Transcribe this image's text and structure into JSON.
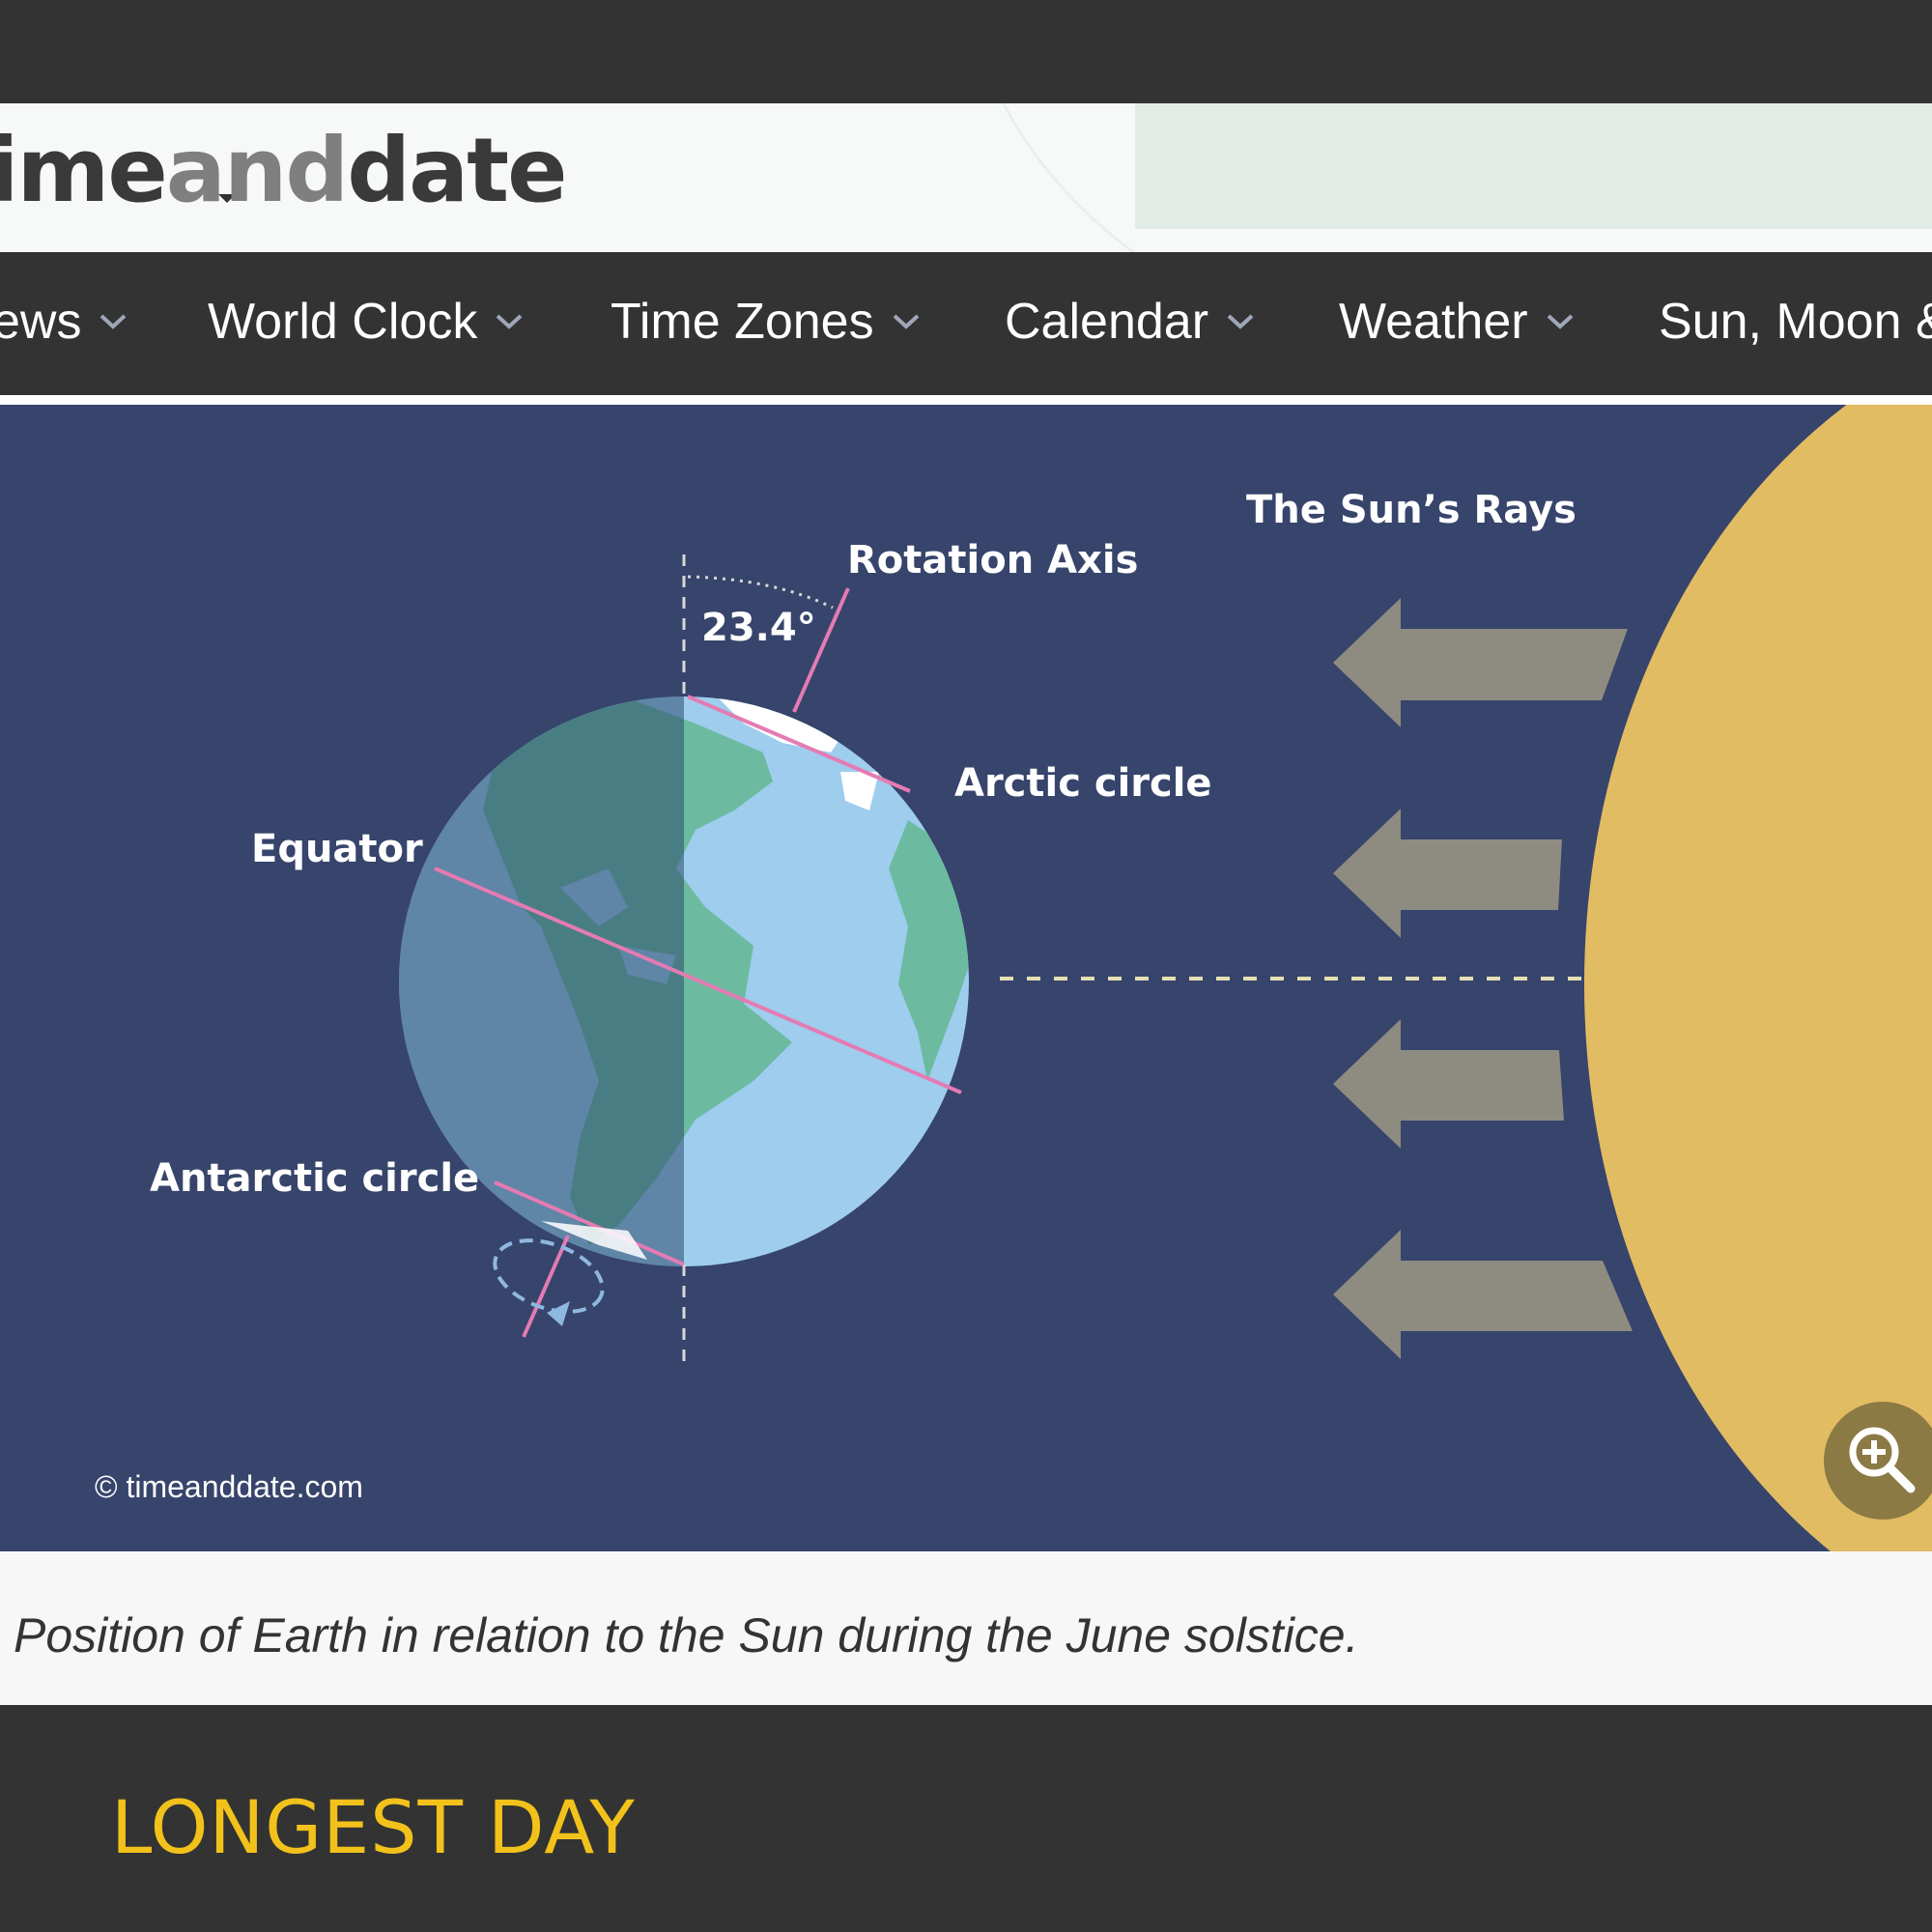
{
  "site": {
    "logo_prefix": "ime",
    "logo_middle": "and",
    "logo_suffix": "date"
  },
  "nav": {
    "items": [
      {
        "label": "ews"
      },
      {
        "label": "World Clock"
      },
      {
        "label": "Time Zones"
      },
      {
        "label": "Calendar"
      },
      {
        "label": "Weather"
      },
      {
        "label": "Sun, Moon &"
      }
    ]
  },
  "diagram": {
    "rotation_axis_label": "Rotation Axis",
    "tilt_label": "23.4°",
    "sun_rays_label": "The Sun’s Rays",
    "arctic_label": "Arctic circle",
    "equator_label": "Equator",
    "antarctic_label": "Antarctic circle",
    "copyright": "© timeanddate.com",
    "colors": {
      "background": "#37446b",
      "sun": "#e2bc63",
      "ocean": "#9ecdee",
      "land": "#6cbba0",
      "night": "#3d5d7b",
      "axis": "#e47bb3",
      "arrow": "#8e8b81"
    }
  },
  "zoom": {
    "icon": "zoom-in-icon"
  },
  "caption": {
    "text": "Position of Earth in relation to the Sun during the June solstice."
  },
  "footer": {
    "heading": "LONGEST DAY"
  }
}
